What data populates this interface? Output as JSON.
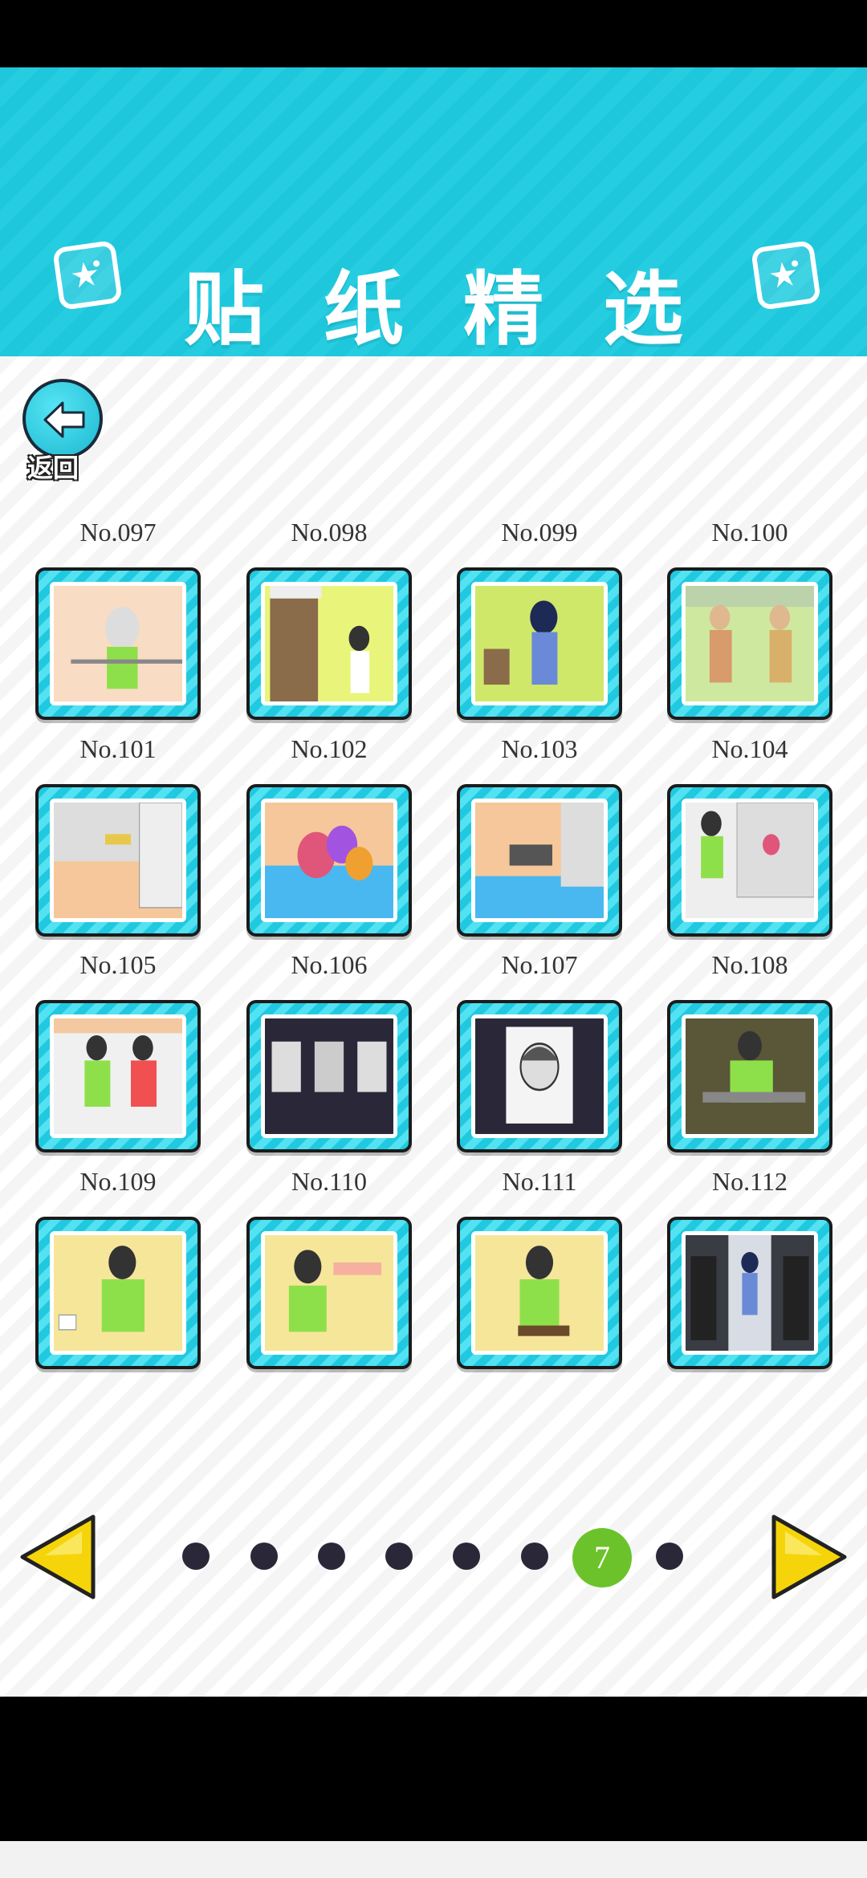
{
  "header": {
    "title": "贴纸精选"
  },
  "back": {
    "label": "返回"
  },
  "stickers": [
    {
      "label": "No.097",
      "scene": "elder-hands-up"
    },
    {
      "label": "No.098",
      "scene": "boy-at-door"
    },
    {
      "label": "No.099",
      "scene": "girl-with-basket"
    },
    {
      "label": "No.100",
      "scene": "two-monks"
    },
    {
      "label": "No.101",
      "scene": "open-locker"
    },
    {
      "label": "No.102",
      "scene": "gift-pile"
    },
    {
      "label": "No.103",
      "scene": "boy-fallen"
    },
    {
      "label": "No.104",
      "scene": "boy-and-lockers"
    },
    {
      "label": "No.105",
      "scene": "two-boys"
    },
    {
      "label": "No.106",
      "scene": "portraits"
    },
    {
      "label": "No.107",
      "scene": "boy-portrait"
    },
    {
      "label": "No.108",
      "scene": "boy-dark-room"
    },
    {
      "label": "No.109",
      "scene": "boy-from-behind"
    },
    {
      "label": "No.110",
      "scene": "boy-drinking"
    },
    {
      "label": "No.111",
      "scene": "boy-eating"
    },
    {
      "label": "No.112",
      "scene": "girl-spotlight"
    }
  ],
  "pager": {
    "current": "7",
    "total_pages": 8,
    "current_index": 7
  },
  "colors": {
    "accent": "#1fc7dc",
    "active_dot": "#6cc22a",
    "arrow": "#f5d50a"
  }
}
